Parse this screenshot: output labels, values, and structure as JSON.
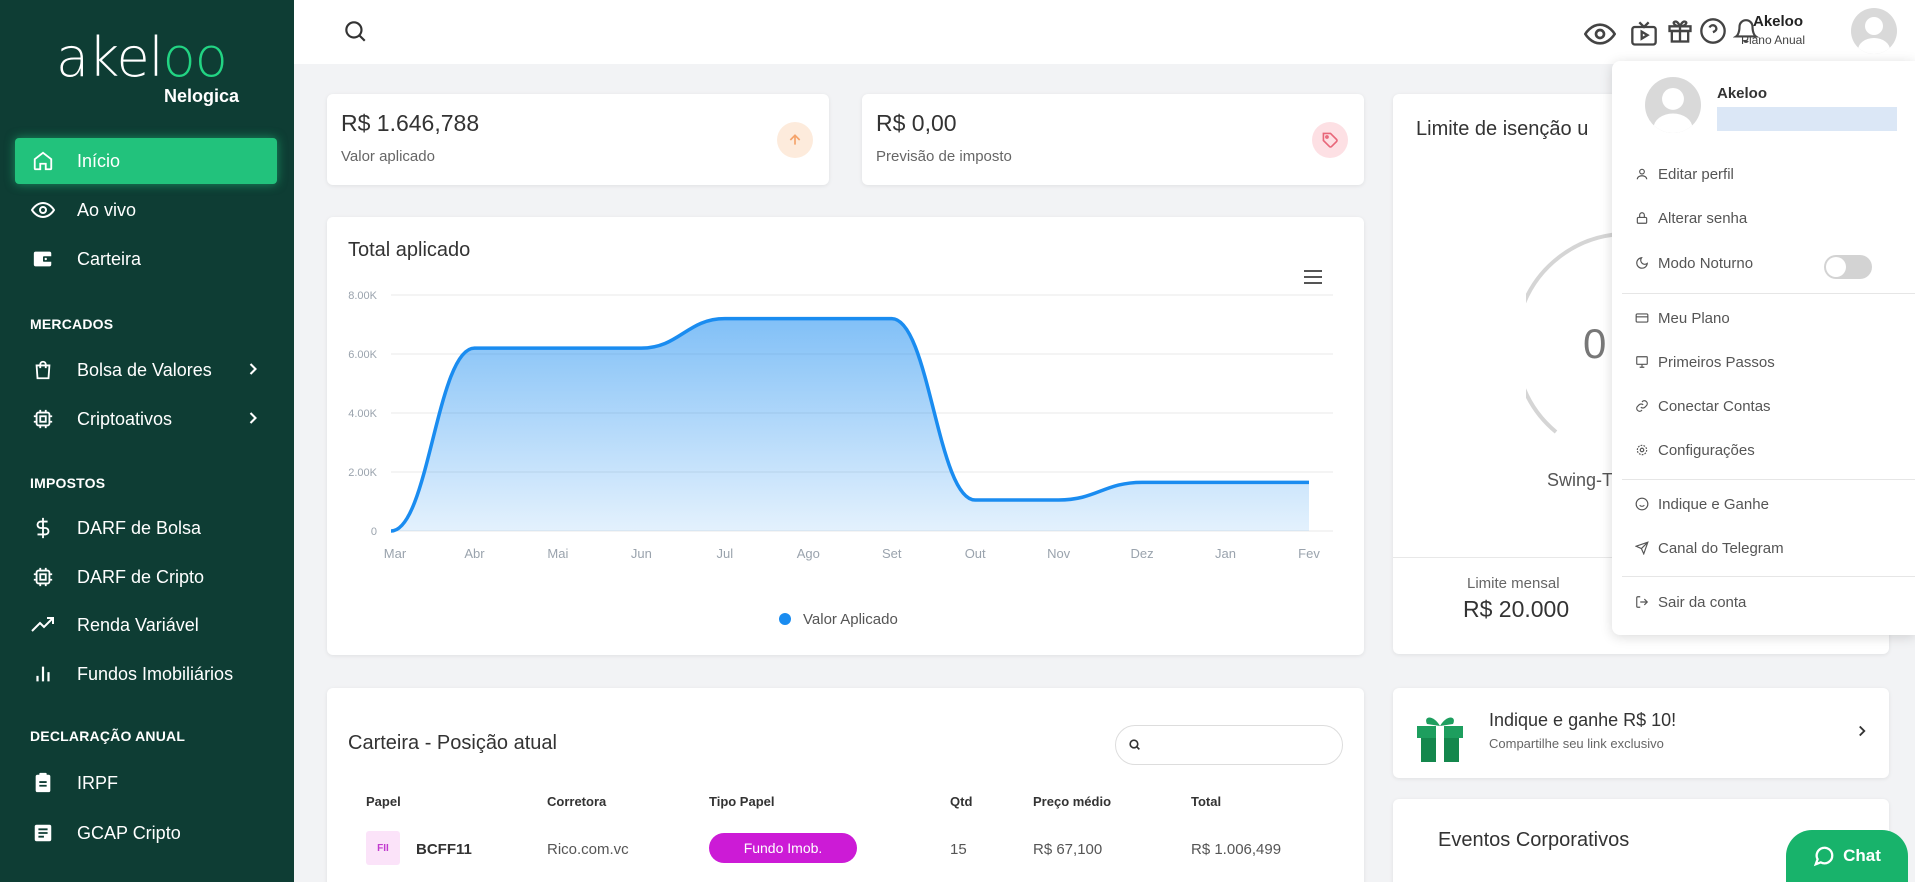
{
  "brand": {
    "name": "akeloo",
    "name_prefix": "akel",
    "name_suffix": "oo",
    "sub": "Nelogica",
    "accent": "#22d483",
    "sidebar_bg": "#0e3d34"
  },
  "sidebar": {
    "main": [
      {
        "label": "Início",
        "icon": "home-icon",
        "active": true
      },
      {
        "label": "Ao vivo",
        "icon": "eye-icon"
      },
      {
        "label": "Carteira",
        "icon": "wallet-icon"
      }
    ],
    "mercados_title": "MERCADOS",
    "mercados": [
      {
        "label": "Bolsa de Valores",
        "icon": "shopping-bag-icon"
      },
      {
        "label": "Criptoativos",
        "icon": "chip-icon"
      }
    ],
    "impostos_title": "IMPOSTOS",
    "impostos": [
      {
        "label": "DARF de Bolsa",
        "icon": "dollar-icon"
      },
      {
        "label": "DARF de Cripto",
        "icon": "chip-icon"
      },
      {
        "label": "Renda Variável",
        "icon": "trend-up-icon"
      },
      {
        "label": "Fundos Imobiliários",
        "icon": "bar-chart-icon"
      }
    ],
    "declaracao_title": "DECLARAÇÃO ANUAL",
    "declaracao": [
      {
        "label": "IRPF",
        "icon": "clipboard-icon"
      },
      {
        "label": "GCAP Cripto",
        "icon": "document-icon"
      }
    ]
  },
  "topbar": {
    "user_name": "Akeloo",
    "user_plan": "Plano Anual"
  },
  "stats": [
    {
      "value": "R$ 1.646,788",
      "label": "Valor aplicado",
      "icon": "arrow-up-icon",
      "color": "#f5a36a"
    },
    {
      "value": "R$ 0,00",
      "label": "Previsão de imposto",
      "icon": "tag-icon",
      "color": "#e8677a"
    }
  ],
  "chart": {
    "title": "Total aplicado",
    "legend": "Valor Aplicado",
    "color": "#1a8cf0"
  },
  "chart_data": {
    "type": "area",
    "title": "Total aplicado",
    "categories": [
      "Mar",
      "Abr",
      "Mai",
      "Jun",
      "Jul",
      "Ago",
      "Set",
      "Out",
      "Nov",
      "Dez",
      "Jan",
      "Fev"
    ],
    "y_ticks": [
      "0",
      "2.00K",
      "4.00K",
      "6.00K",
      "8.00K"
    ],
    "ylim": [
      0,
      8000
    ],
    "series": [
      {
        "name": "Valor Aplicado",
        "values": [
          0,
          6200,
          6200,
          6200,
          7200,
          7200,
          7200,
          1050,
          1050,
          1650,
          1650,
          1650
        ]
      }
    ],
    "legend_position": "bottom"
  },
  "isencao": {
    "title": "Limite de isenção u",
    "gauge_value": "0",
    "gauge_label": "Swing-T",
    "limit_label": "Limite mensal",
    "limit_value": "R$ 20.000"
  },
  "carteira": {
    "title": "Carteira - Posição atual",
    "search_placeholder": "",
    "columns": [
      "Papel",
      "Corretora",
      "Tipo Papel",
      "Qtd",
      "Preço médio",
      "Total"
    ],
    "rows": [
      {
        "badge": "FII",
        "papel": "BCFF11",
        "corretora": "Rico.com.vc",
        "tipo": "Fundo Imob.",
        "qtd": "15",
        "preco": "R$ 67,100",
        "total": "R$ 1.006,499"
      }
    ]
  },
  "indique": {
    "title": "Indique e ganhe R$ 10!",
    "subtitle": "Compartilhe seu link exclusivo"
  },
  "eventos": {
    "title": "Eventos Corporativos"
  },
  "dropdown": {
    "name": "Akeloo",
    "items": [
      {
        "label": "Editar perfil",
        "icon": "user-icon"
      },
      {
        "label": "Alterar senha",
        "icon": "lock-icon"
      },
      {
        "label": "Modo Noturno",
        "icon": "moon-icon"
      },
      {
        "label": "Meu Plano",
        "icon": "credit-card-icon"
      },
      {
        "label": "Primeiros Passos",
        "icon": "presentation-icon"
      },
      {
        "label": "Conectar Contas",
        "icon": "link-icon"
      },
      {
        "label": "Configurações",
        "icon": "settings-icon"
      },
      {
        "label": "Indique e Ganhe",
        "icon": "smile-icon"
      },
      {
        "label": "Canal do Telegram",
        "icon": "send-icon"
      },
      {
        "label": "Sair da conta",
        "icon": "logout-icon"
      }
    ],
    "dark_mode": false
  },
  "chat": {
    "label": "Chat"
  }
}
